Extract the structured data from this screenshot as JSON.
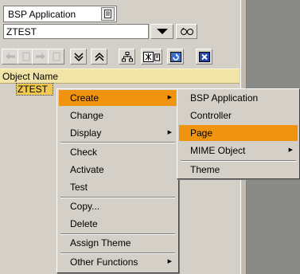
{
  "app_selector": {
    "value": "BSP Application"
  },
  "object_input": {
    "value": "ZTEST"
  },
  "tree": {
    "header": "Object Name",
    "item": "ZTEST"
  },
  "context_menu": {
    "items": [
      {
        "label": "Create",
        "has_submenu": true,
        "active": true
      },
      {
        "label": "Change"
      },
      {
        "label": "Display",
        "has_submenu": true
      },
      {
        "label": "Check"
      },
      {
        "label": "Activate"
      },
      {
        "label": "Test"
      },
      {
        "label": "Copy..."
      },
      {
        "label": "Delete"
      },
      {
        "label": "Assign Theme"
      },
      {
        "label": "Other Functions",
        "has_submenu": true
      }
    ]
  },
  "create_submenu": {
    "items": [
      {
        "label": "BSP Application"
      },
      {
        "label": "Controller"
      },
      {
        "label": "Page",
        "active": true
      },
      {
        "label": "MIME Object",
        "has_submenu": true
      },
      {
        "label": "Theme"
      }
    ]
  },
  "icons": {
    "app_select_btn": "list-icon",
    "dropdown": "triangle-down-icon",
    "display": "glasses-icon",
    "toolbar": [
      "back-icon",
      "back-page-icon",
      "forward-icon",
      "forward-page-icon",
      "expand-icon",
      "collapse-icon",
      "hierarchy-icon",
      "select-icon",
      "refresh-icon",
      "close-icon"
    ]
  },
  "colors": {
    "highlight": "#f0940f",
    "header_bg": "#f2e3a6",
    "tree_item_bg": "#f0c850",
    "window_bg": "#d4d0c8"
  }
}
